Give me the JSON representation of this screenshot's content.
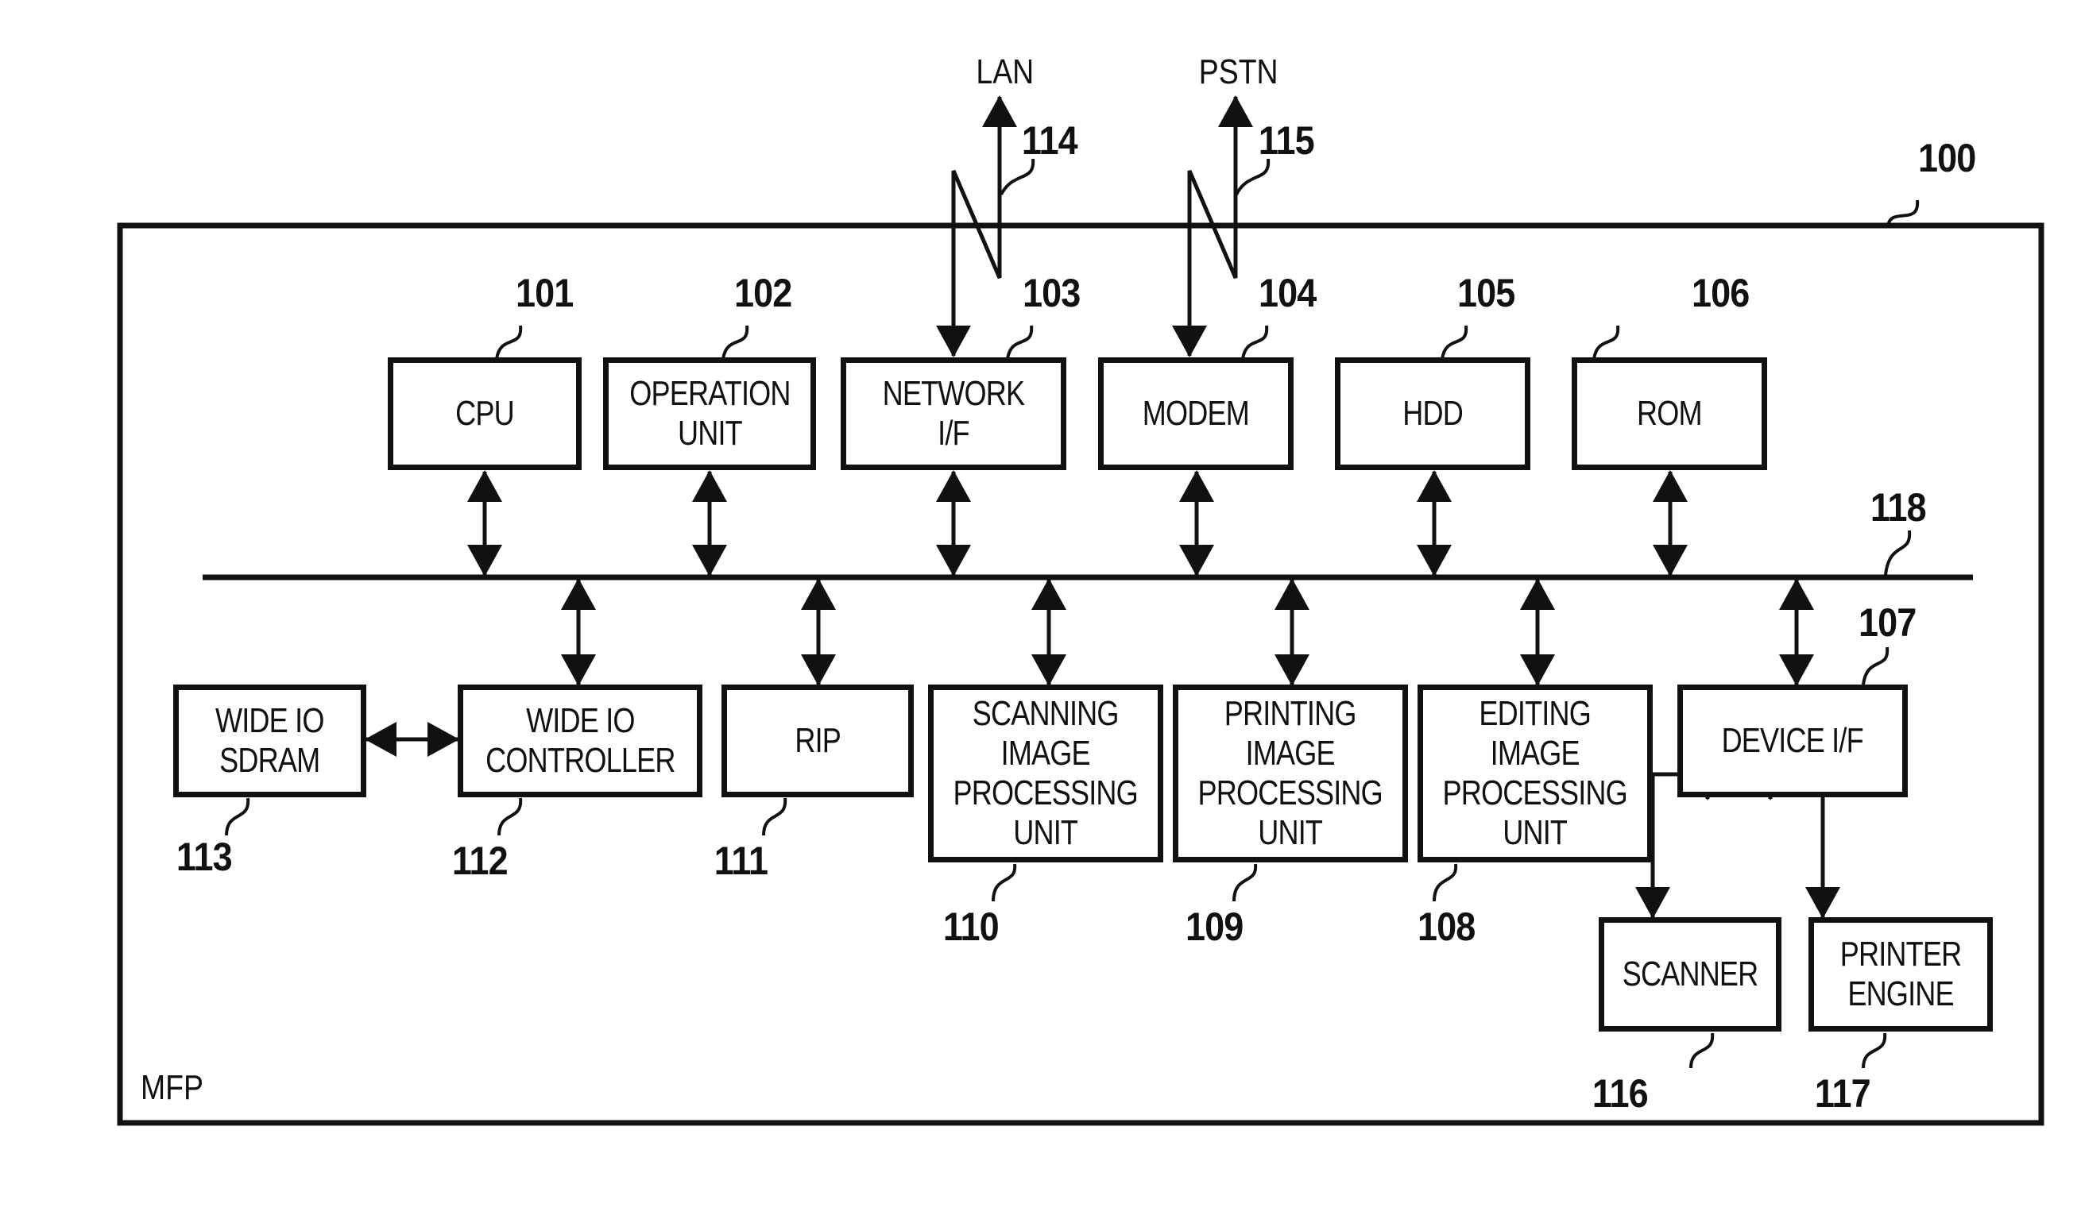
{
  "figure": {
    "container_label": "MFP",
    "container_ref": "100",
    "bus_ref": "118",
    "external": {
      "lan": {
        "label": "LAN",
        "ref": "114"
      },
      "pstn": {
        "label": "PSTN",
        "ref": "115"
      }
    },
    "top_row": [
      {
        "id": "cpu",
        "label": "CPU",
        "ref": "101"
      },
      {
        "id": "operation-unit",
        "label": "OPERATION\nUNIT",
        "ref": "102"
      },
      {
        "id": "network-if",
        "label": "NETWORK\nI/F",
        "ref": "103"
      },
      {
        "id": "modem",
        "label": "MODEM",
        "ref": "104"
      },
      {
        "id": "hdd",
        "label": "HDD",
        "ref": "105"
      },
      {
        "id": "rom",
        "label": "ROM",
        "ref": "106"
      }
    ],
    "bottom_row": [
      {
        "id": "wide-io-sdram",
        "label": "WIDE IO\nSDRAM",
        "ref": "113"
      },
      {
        "id": "wide-io-controller",
        "label": "WIDE IO\nCONTROLLER",
        "ref": "112"
      },
      {
        "id": "rip",
        "label": "RIP",
        "ref": "111"
      },
      {
        "id": "scanning-image-processing-unit",
        "label": "SCANNING\nIMAGE\nPROCESSING\nUNIT",
        "ref": "110"
      },
      {
        "id": "printing-image-processing-unit",
        "label": "PRINTING\nIMAGE\nPROCESSING\nUNIT",
        "ref": "109"
      },
      {
        "id": "editing-image-processing-unit",
        "label": "EDITING\nIMAGE\nPROCESSING\nUNIT",
        "ref": "108"
      },
      {
        "id": "device-if",
        "label": "DEVICE I/F",
        "ref": "107"
      }
    ],
    "peripherals": [
      {
        "id": "scanner",
        "label": "SCANNER",
        "ref": "116"
      },
      {
        "id": "printer-engine",
        "label": "PRINTER\nENGINE",
        "ref": "117"
      }
    ]
  }
}
